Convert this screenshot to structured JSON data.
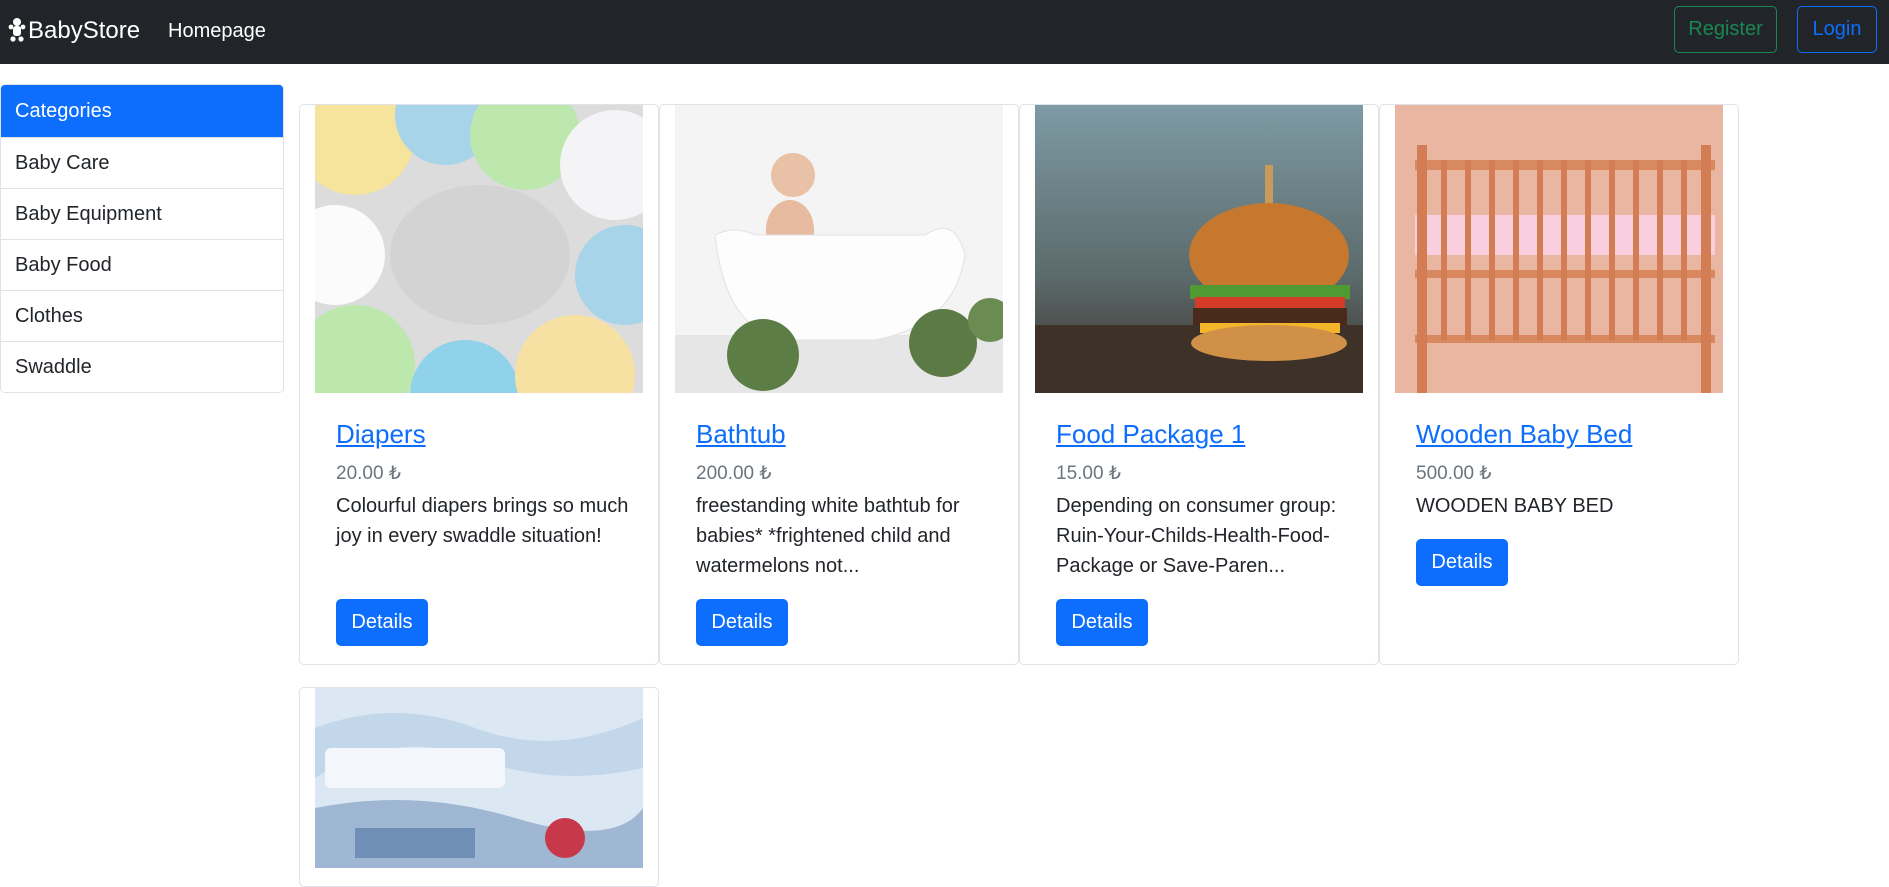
{
  "navbar": {
    "brand": "BabyStore",
    "home_link": "Homepage",
    "register_label": "Register",
    "login_label": "Login"
  },
  "sidebar": {
    "header": "Categories",
    "items": [
      {
        "label": "Baby Care"
      },
      {
        "label": "Baby Equipment"
      },
      {
        "label": "Baby Food"
      },
      {
        "label": "Clothes"
      },
      {
        "label": "Swaddle"
      }
    ]
  },
  "products": [
    {
      "title": "Diapers",
      "price": "20.00 ₺",
      "description": "Colourful diapers brings so much joy in every swaddle situation!",
      "button": "Details"
    },
    {
      "title": "Bathtub",
      "price": "200.00 ₺",
      "description": "freestanding white bathtub for babies* *frightened child and watermelons not...",
      "button": "Details"
    },
    {
      "title": "Food Package 1",
      "price": "15.00 ₺",
      "description": "Depending on consumer group: Ruin-Your-Childs-Health-Food-Package or Save-Paren...",
      "button": "Details"
    },
    {
      "title": "Wooden Baby Bed",
      "price": "500.00 ₺",
      "description": "WOODEN BABY BED",
      "button": "Details"
    }
  ],
  "colors": {
    "navbar_bg": "#212529",
    "primary": "#0d6efd",
    "success": "#198754",
    "muted": "#6c757d"
  }
}
